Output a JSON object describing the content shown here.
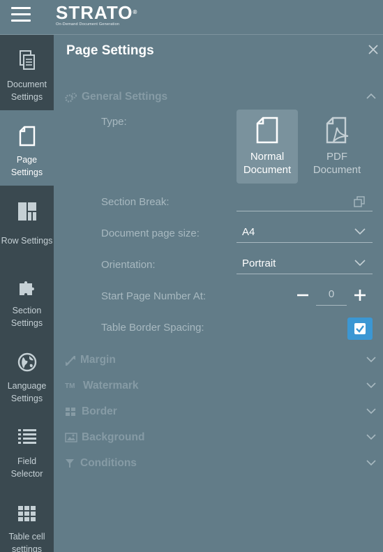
{
  "app": {
    "logo_text": "STRATO",
    "logo_tm": "®",
    "logo_tagline": "On-Demand Document Generation"
  },
  "sidebar": {
    "items": [
      {
        "label_line1": "Document",
        "label_line2": "Settings",
        "icon": "document-settings-icon"
      },
      {
        "label_line1": "Page",
        "label_line2": "Settings",
        "icon": "page-icon"
      },
      {
        "label_line1": "Row Settings",
        "label_line2": "",
        "icon": "row-layout-icon"
      },
      {
        "label_line1": "Section",
        "label_line2": "Settings",
        "icon": "puzzle-icon"
      },
      {
        "label_line1": "Language",
        "label_line2": "Settings",
        "icon": "globe-icon"
      },
      {
        "label_line1": "Field",
        "label_line2": "Selector",
        "icon": "list-icon"
      },
      {
        "label_line1": "Table cell",
        "label_line2": "settings",
        "icon": "grid-icon"
      }
    ]
  },
  "panel": {
    "title": "Page Settings"
  },
  "general": {
    "heading": "General Settings",
    "type_label": "Type:",
    "type_options": [
      {
        "line1": "Normal",
        "line2": "Document",
        "selected": true
      },
      {
        "line1": "PDF",
        "line2": "Document",
        "selected": false
      }
    ],
    "section_break_label": "Section Break:",
    "page_size_label": "Document page size:",
    "page_size_value": "A4",
    "orientation_label": "Orientation:",
    "orientation_value": "Portrait",
    "start_page_label": "Start Page Number At:",
    "start_page_value": "0",
    "table_border_label": "Table Border Spacing:",
    "table_border_checked": true
  },
  "sections": {
    "margin": "Margin",
    "watermark": "Watermark",
    "border": "Border",
    "background": "Background",
    "conditions": "Conditions"
  },
  "colors": {
    "sidebar_bg": "#3a4950",
    "panel_bg": "#627c88",
    "accent": "#3b97d3"
  }
}
